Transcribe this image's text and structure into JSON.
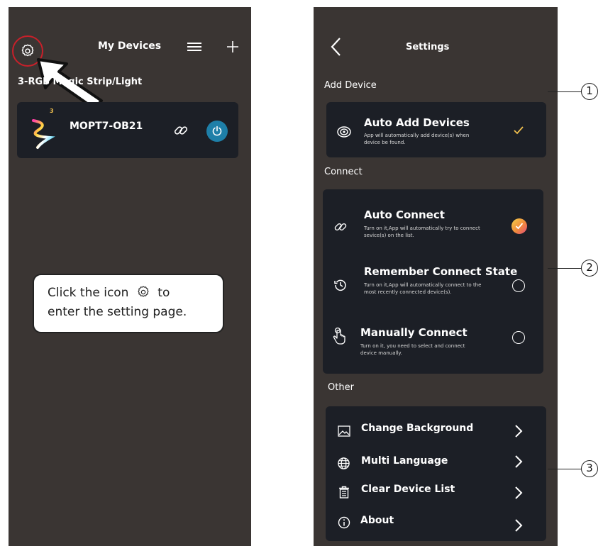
{
  "left": {
    "header_title": "My Devices",
    "group_label": "3-RGB Magic Strip/Light",
    "device_name": "MOPT7-OB21",
    "device_badge": "3",
    "tooltip_line1_before": "Click the icon",
    "tooltip_line1_after": "to",
    "tooltip_line2": "enter the setting page."
  },
  "right": {
    "header_title": "Settings",
    "sections": {
      "add_device": "Add Device",
      "connect": "Connect",
      "other": "Other"
    },
    "auto_add": {
      "title": "Auto Add Devices",
      "desc1": "App will automatically add device(s) when",
      "desc2": "device be found."
    },
    "auto_connect": {
      "title": "Auto Connect",
      "desc1": "Turn on it,App will automatically try to connect",
      "desc2": "sevice(s) on the list."
    },
    "remember": {
      "title": "Remember Connect State",
      "desc1": "Turn on it,App will automatically connect to the",
      "desc2": "most recently connected device(s)."
    },
    "manual": {
      "title": "Manually Connect",
      "desc1": "Turn on it, you need to select and connect",
      "desc2": "device manually."
    },
    "other_items": [
      "Change Background",
      "Multi Language",
      "Clear Device List",
      "About"
    ]
  },
  "callouts": [
    "1",
    "2",
    "3"
  ],
  "colors": {
    "phone_bg": "#3a3533",
    "card_bg": "#1c1f26",
    "accent_yellow": "#f2c14e",
    "power_blue": "#1e7fa8",
    "highlight_red": "#c8202a"
  }
}
